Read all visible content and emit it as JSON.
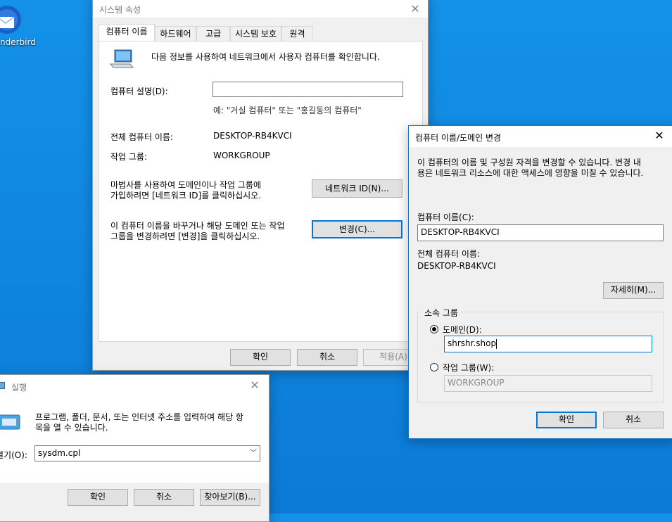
{
  "desktop": {
    "thunderbird_label": "nderbird"
  },
  "system_properties": {
    "title": "시스템 속성",
    "tabs": [
      "컴퓨터 이름",
      "하드웨어",
      "고급",
      "시스템 보호",
      "원격"
    ],
    "intro": "다음 정보를 사용하여 네트워크에서 사용자 컴퓨터를 확인합니다.",
    "desc_label": "컴퓨터 설명(D):",
    "desc_value": "",
    "desc_example": "예: \"거실 컴퓨터\" 또는 \"홍길동의 컴퓨터\"",
    "full_name_label": "전체 컴퓨터 이름:",
    "full_name_value": "DESKTOP-RB4KVCI",
    "workgroup_label": "작업 그룹:",
    "workgroup_value": "WORKGROUP",
    "network_text_1": "마법사를 사용하여 도메인이나 작업 그룹에",
    "network_text_2": "가입하려면 [네트워크 ID]를 클릭하십시오.",
    "network_button": "네트워크 ID(N)...",
    "change_text_1": "이 컴퓨터 이름을 바꾸거나 해당 도메인 또는 작업",
    "change_text_2": "그룹을 변경하려면 [변경]을 클릭하십시오.",
    "change_button": "변경(C)...",
    "ok": "확인",
    "cancel": "취소",
    "apply": "적용(A)"
  },
  "rename_dialog": {
    "title": "컴퓨터 이름/도메인 변경",
    "intro_1": "이 컴퓨터의 이름 및 구성원 자격을 변경할 수 있습니다. 변경 내",
    "intro_2": "용은 네트워크 리소스에 대한 액세스에 영향을 미칠 수 있습니다.",
    "name_label": "컴퓨터 이름(C):",
    "name_value": "DESKTOP-RB4KVCI",
    "full_name_label": "전체 컴퓨터 이름:",
    "full_name_value": "DESKTOP-RB4KVCI",
    "more_button": "자세히(M)...",
    "member_group": "소속 그룹",
    "domain_label": "도메인(D):",
    "domain_value": "shrshr.shop",
    "workgroup_label": "작업 그룹(W):",
    "workgroup_value": "WORKGROUP",
    "ok": "확인",
    "cancel": "취소"
  },
  "run_dialog": {
    "title": "실행",
    "text_1": "프로그램, 폴더, 문서, 또는 인터넷 주소를 입력하여 해당 항",
    "text_2": "목을 열 수 있습니다.",
    "open_label": "열기(O):",
    "open_value": "sysdm.cpl",
    "ok": "확인",
    "cancel": "취소",
    "browse": "찾아보기(B)..."
  }
}
